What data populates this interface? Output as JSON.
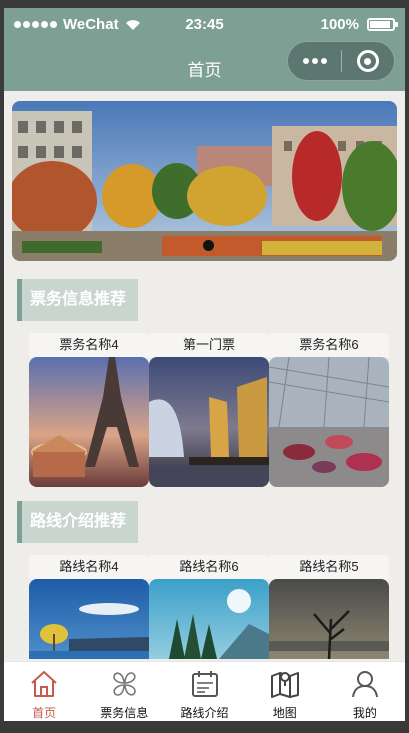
{
  "status_bar": {
    "carrier": "WeChat",
    "time": "23:45",
    "battery": "100%"
  },
  "nav": {
    "title": "首页"
  },
  "banner": {
    "slides": 1,
    "active_index": 0
  },
  "sections": [
    {
      "title": "票务信息推荐",
      "cards": [
        {
          "name": "票务名称4",
          "image": "eiffel-tower-carousel"
        },
        {
          "name": "第一门票",
          "image": "sailboats-sunset"
        },
        {
          "name": "票务名称6",
          "image": "bumper-cars"
        }
      ]
    },
    {
      "title": "路线介绍推荐",
      "cards": [
        {
          "name": "路线名称4",
          "image": "lake-tree-blue"
        },
        {
          "name": "路线名称6",
          "image": "mountain-lake-pines"
        },
        {
          "name": "路线名称5",
          "image": "lone-tree-lake-sunset"
        }
      ]
    }
  ],
  "tabbar": {
    "accent": "#c75a4b",
    "items": [
      {
        "label": "首页",
        "icon": "home-icon",
        "active": true
      },
      {
        "label": "票务信息",
        "icon": "clover-icon",
        "active": false
      },
      {
        "label": "路线介绍",
        "icon": "calendar-icon",
        "active": false
      },
      {
        "label": "地图",
        "icon": "map-icon",
        "active": false
      },
      {
        "label": "我的",
        "icon": "user-icon",
        "active": false
      }
    ]
  },
  "colors": {
    "theme": "#7d9f94",
    "section_bg": "#c9d5cf"
  }
}
